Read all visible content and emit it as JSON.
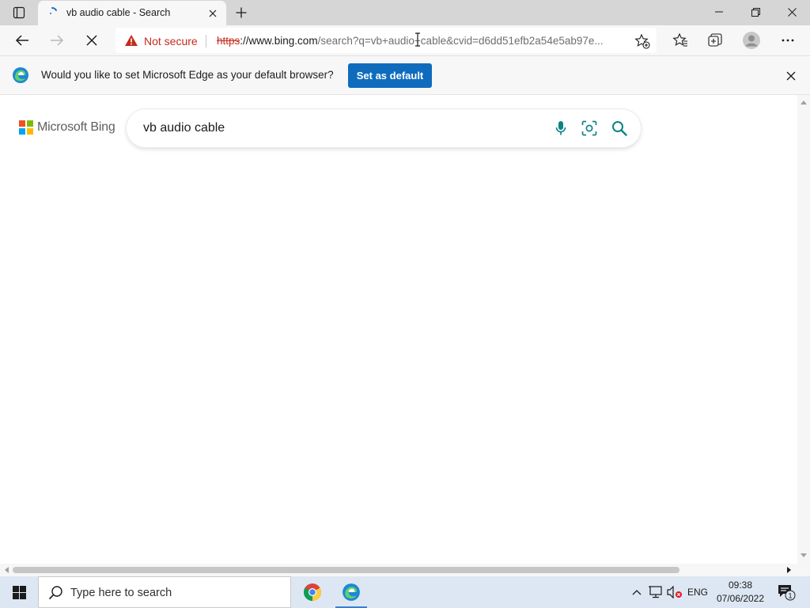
{
  "browser": {
    "tab": {
      "title": "vb audio cable - Search"
    },
    "address_bar": {
      "security_label": "Not secure",
      "url_scheme": "https",
      "url_host": "://www.bing.com",
      "url_rest": "/search?q=vb+audio+cable&cvid=d6dd51efb2a54e5ab97e..."
    },
    "infobar": {
      "message": "Would you like to set Microsoft Edge as your default browser?",
      "button_label": "Set as default"
    }
  },
  "page": {
    "logo_text": "Microsoft Bing",
    "search_query": "vb audio cable"
  },
  "taskbar": {
    "search_placeholder": "Type here to search",
    "language": "ENG",
    "time": "09:38",
    "date": "07/06/2022",
    "notification_count": "1"
  },
  "colors": {
    "accent": "#0f6cbd",
    "warning": "#c42b1c",
    "bing_teal": "#0c8484"
  }
}
